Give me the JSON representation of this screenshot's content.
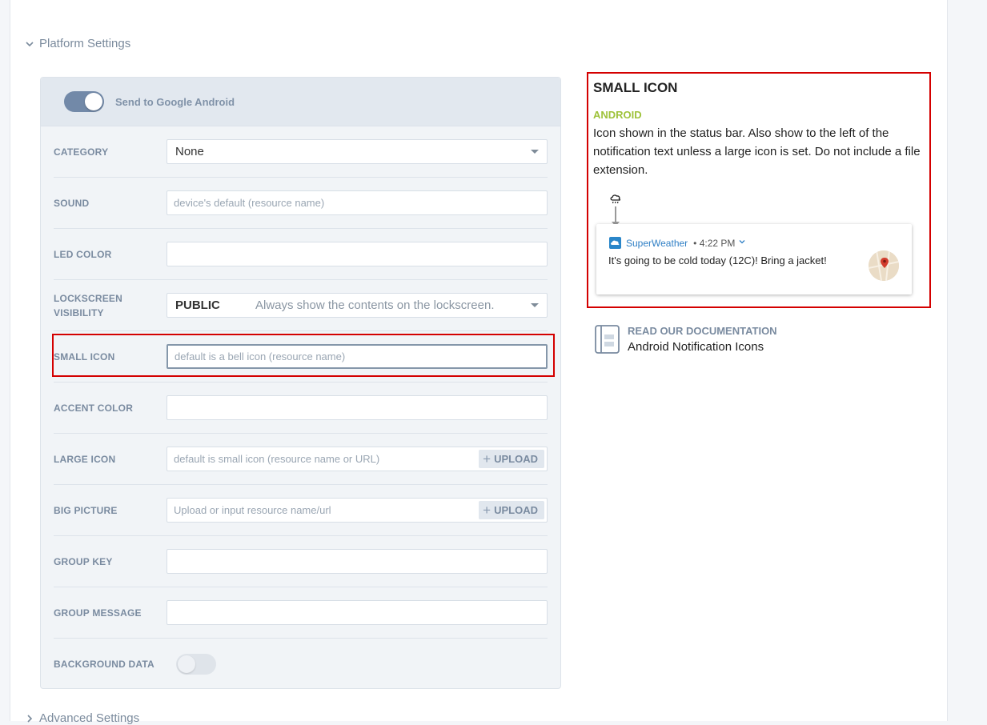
{
  "sections": {
    "platform_settings": "Platform Settings",
    "advanced_settings": "Advanced Settings"
  },
  "panel": {
    "send_toggle_label": "Send to Google Android",
    "send_toggle_on": true
  },
  "fields": {
    "category": {
      "label": "CATEGORY",
      "value": "None"
    },
    "sound": {
      "label": "SOUND",
      "placeholder": "device's default (resource name)"
    },
    "led_color": {
      "label": "LED COLOR",
      "placeholder": ""
    },
    "lockscreen_visibility": {
      "label_line1": "LOCKSCREEN",
      "label_line2": "VISIBILITY",
      "value": "PUBLIC",
      "description": "Always show the contents on the lockscreen."
    },
    "small_icon": {
      "label": "SMALL ICON",
      "placeholder": "default is a bell icon (resource name)"
    },
    "accent_color": {
      "label": "ACCENT COLOR",
      "placeholder": ""
    },
    "large_icon": {
      "label": "LARGE ICON",
      "placeholder": "default is small icon (resource name or URL)",
      "upload_label": "UPLOAD"
    },
    "big_picture": {
      "label": "BIG PICTURE",
      "placeholder": "Upload or input resource name/url",
      "upload_label": "UPLOAD"
    },
    "group_key": {
      "label": "GROUP KEY",
      "placeholder": ""
    },
    "group_message": {
      "label": "GROUP MESSAGE",
      "placeholder": ""
    },
    "background_data": {
      "label": "BACKGROUND DATA",
      "on": false
    }
  },
  "info": {
    "title": "SMALL ICON",
    "platform": "ANDROID",
    "description": "Icon shown in the status bar. Also show to the left of the notification text unless a large icon is set. Do not include a file extension.",
    "notification": {
      "app_name": "SuperWeather",
      "time": "• 4:22 PM",
      "message": "It's going to be cold today (12C)! Bring a jacket!"
    }
  },
  "documentation": {
    "kicker": "READ OUR DOCUMENTATION",
    "title": "Android Notification Icons"
  },
  "colors": {
    "highlight": "#d40000",
    "android_green": "#9ec23a",
    "toggle_on": "#7289a8",
    "app_blue": "#2f7fc5"
  }
}
